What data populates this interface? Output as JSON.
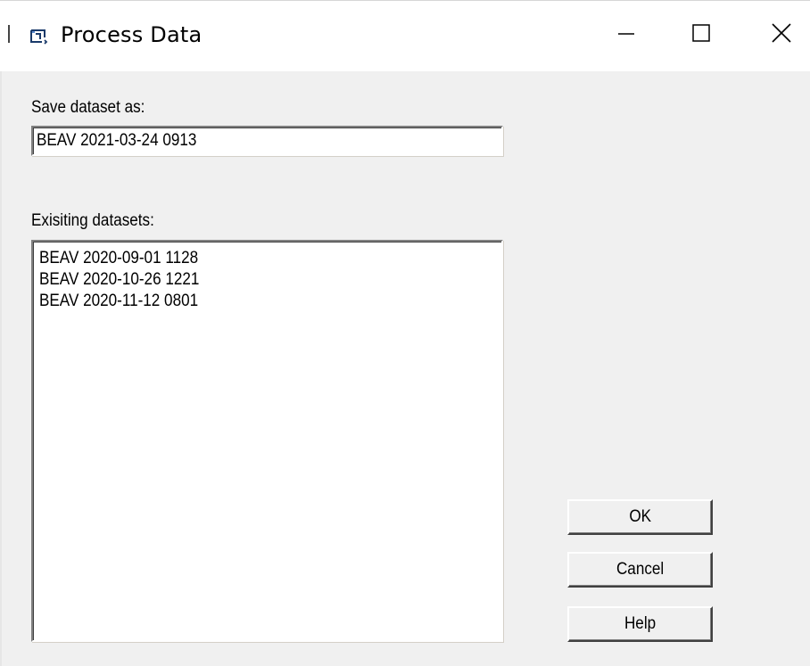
{
  "window": {
    "title": "Process Data",
    "icon": "dialog-window-icon",
    "controls": {
      "minimize": "minimize-icon",
      "maximize": "maximize-icon",
      "close": "close-icon"
    }
  },
  "form": {
    "save_label": "Save dataset as:",
    "save_value": "BEAV 2021-03-24 0913",
    "existing_label": "Exisiting datasets:",
    "existing_items": [
      "BEAV 2020-09-01 1128",
      "BEAV 2020-10-26 1221",
      "BEAV 2020-11-12 0801"
    ]
  },
  "buttons": {
    "ok": "OK",
    "cancel": "Cancel",
    "help": "Help"
  },
  "colors": {
    "dialog_background": "#f0f0f0",
    "titlebar_background": "#ffffff",
    "field_background": "#ffffff"
  }
}
